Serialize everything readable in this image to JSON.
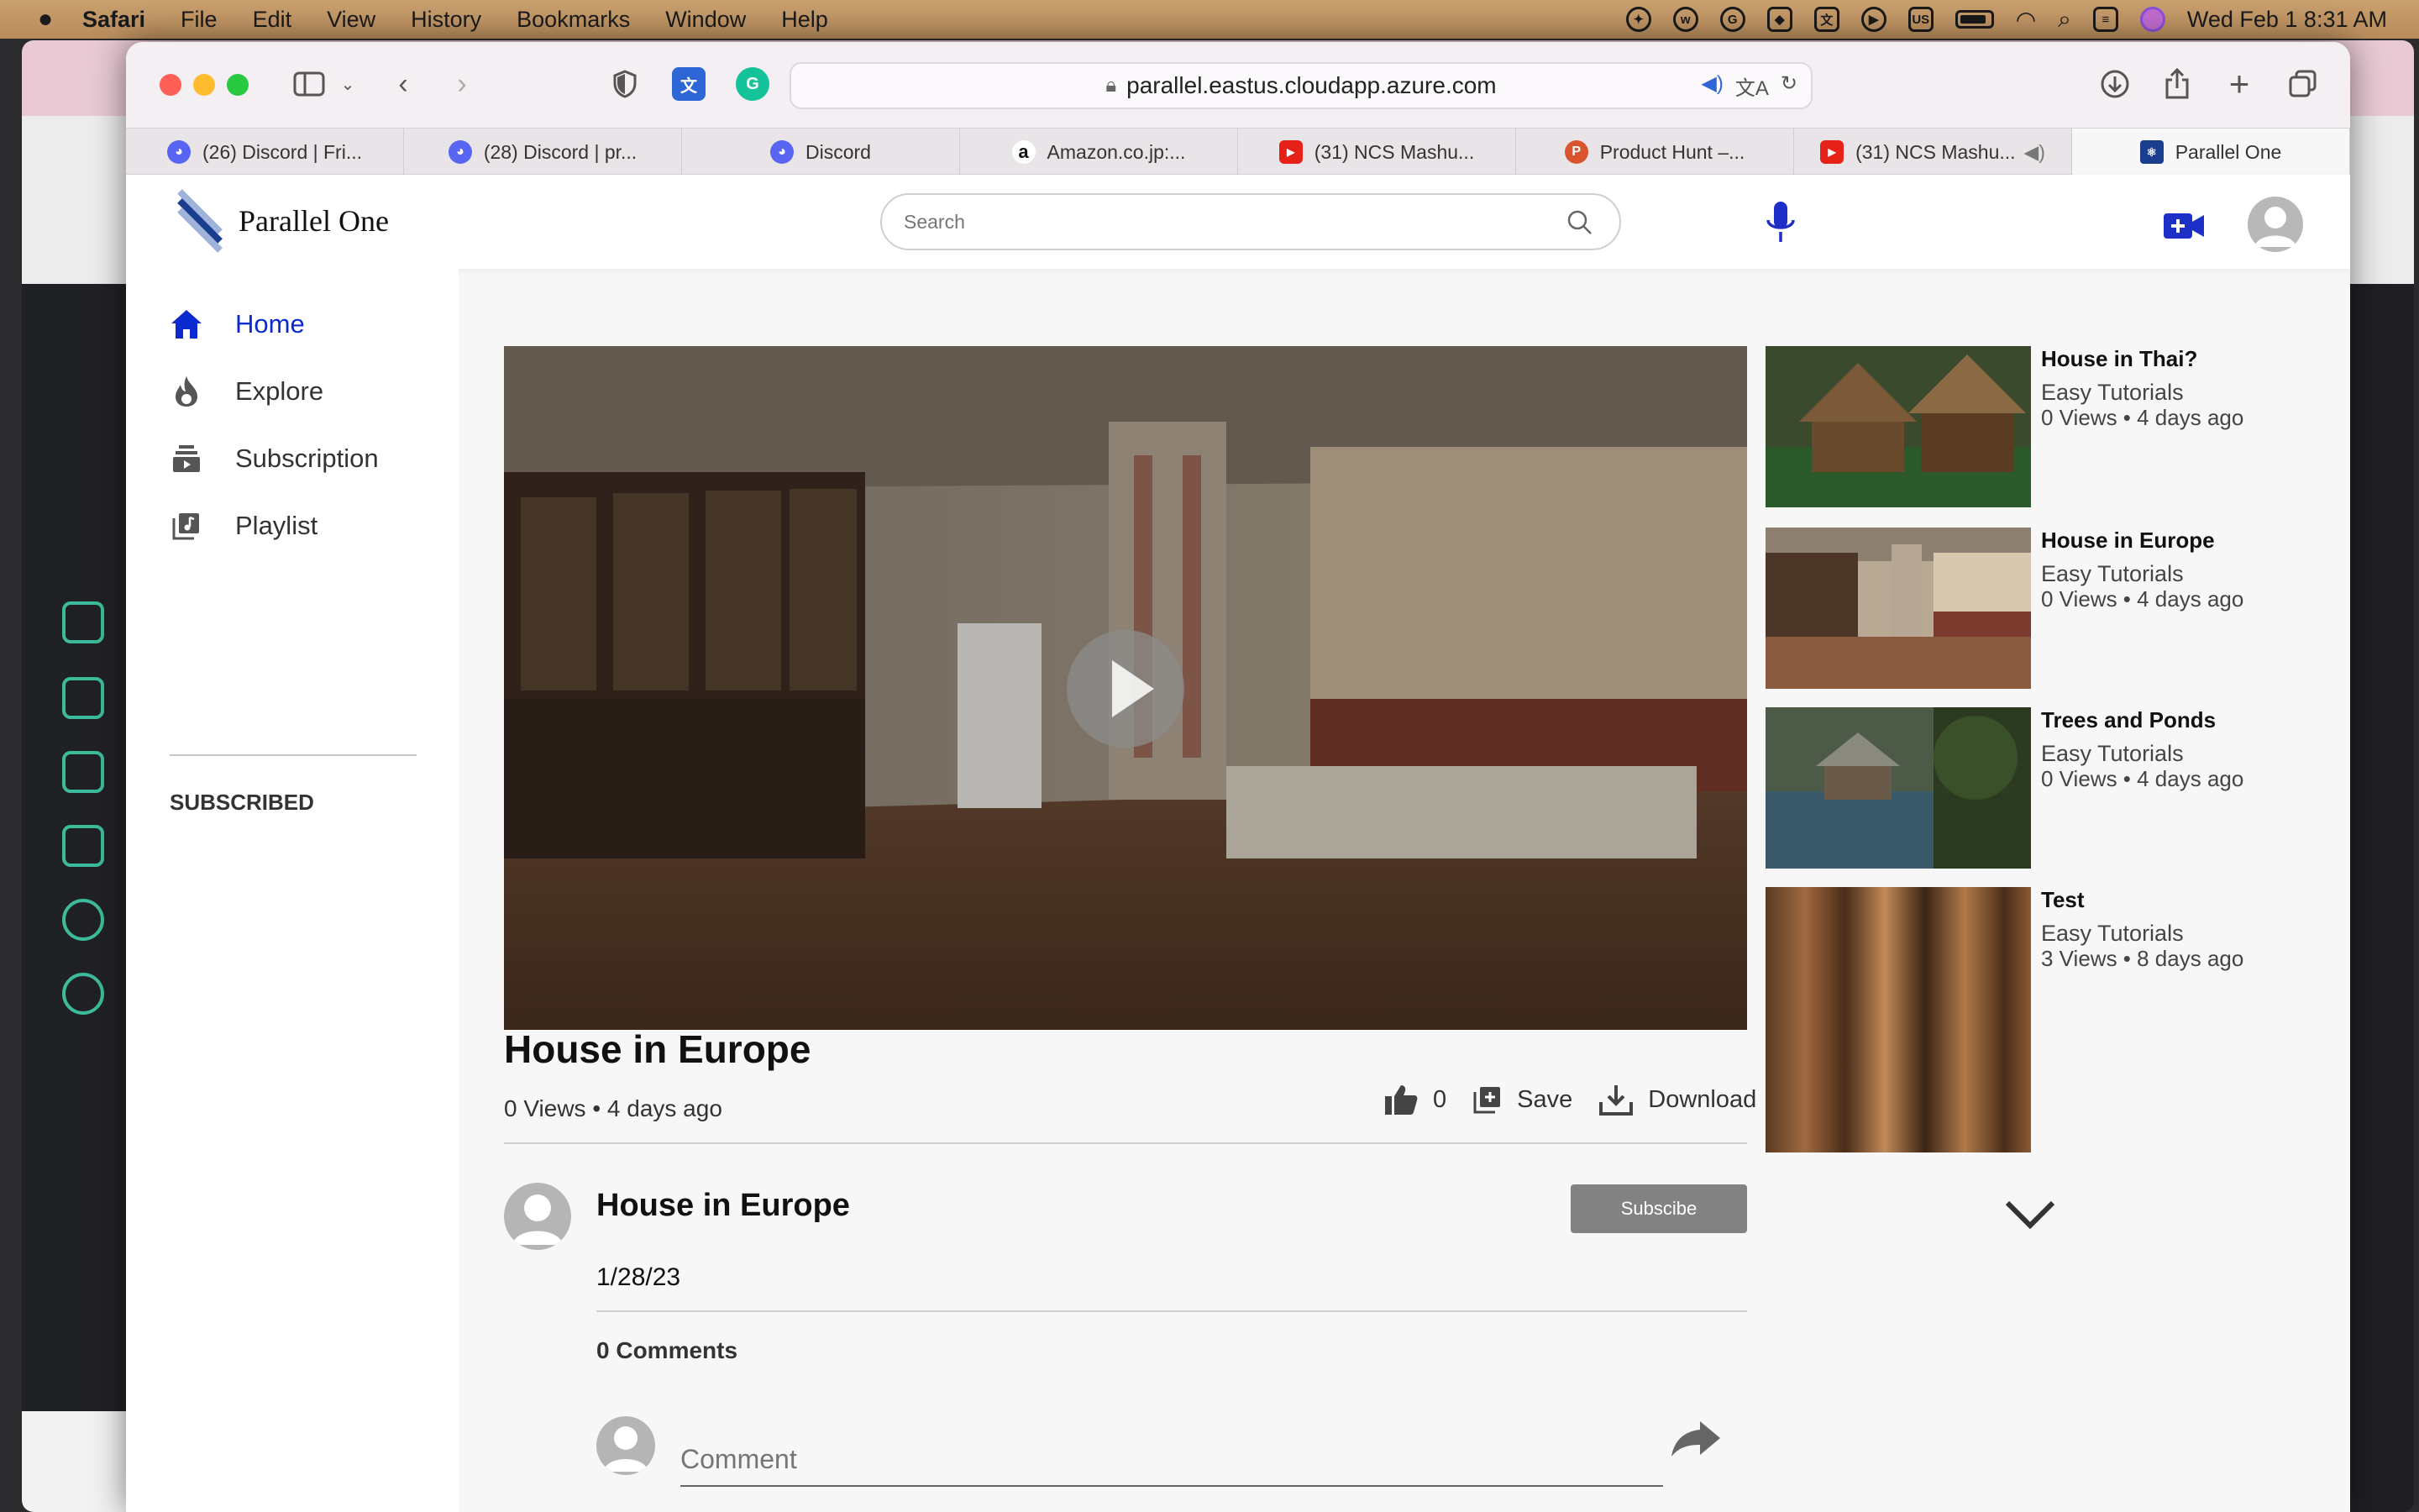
{
  "menubar": {
    "app": "Safari",
    "menus": [
      "File",
      "Edit",
      "View",
      "History",
      "Bookmarks",
      "Window",
      "Help"
    ],
    "input_source": "US",
    "datetime": "Wed Feb 1  8:31 AM"
  },
  "browser": {
    "url": "parallel.eastus.cloudapp.azure.com",
    "tabs": [
      {
        "label": "(26) Discord | Fri...",
        "icon": "discord-icon",
        "color": "#5865f2"
      },
      {
        "label": "(28) Discord | pr...",
        "icon": "discord-icon",
        "color": "#5865f2"
      },
      {
        "label": "Discord",
        "icon": "discord-icon",
        "color": "#5865f2"
      },
      {
        "label": "Amazon.co.jp:...",
        "icon": "amazon-icon",
        "color": "#111111"
      },
      {
        "label": "(31) NCS Mashu...",
        "icon": "youtube-icon",
        "color": "#e62117"
      },
      {
        "label": "Product Hunt –...",
        "icon": "producthunt-icon",
        "color": "#da552f"
      },
      {
        "label": "(31) NCS Mashu...",
        "icon": "youtube-icon",
        "color": "#e62117"
      },
      {
        "label": "Parallel One",
        "icon": "react-icon",
        "color": "#1b3d8f"
      }
    ]
  },
  "site": {
    "name": "Parallel One",
    "search_placeholder": "Search",
    "accent": "#0b2bd0",
    "brand": "#1b3d8f"
  },
  "sidebar": {
    "items": [
      {
        "label": "Home",
        "icon": "home-icon",
        "active": true
      },
      {
        "label": "Explore",
        "icon": "flame-icon",
        "active": false
      },
      {
        "label": "Subscription",
        "icon": "subscription-icon",
        "active": false
      },
      {
        "label": "Playlist",
        "icon": "playlist-icon",
        "active": false
      }
    ],
    "section_title": "SUBSCRIBED"
  },
  "video": {
    "title": "House in Europe",
    "meta": "0 Views • 4 days ago",
    "likes": "0",
    "save_label": "Save",
    "download_label": "Download",
    "channel": "House in Europe",
    "subscribe_label": "Subscibe",
    "date": "1/28/23",
    "comments_count": "0 Comments",
    "comment_placeholder": "Comment"
  },
  "related": [
    {
      "title": "House in Thai?",
      "channel": "Easy Tutorials",
      "meta": "0 Views • 4 days ago"
    },
    {
      "title": "House in Europe",
      "channel": "Easy Tutorials",
      "meta": "0 Views • 4 days ago"
    },
    {
      "title": "Trees and Ponds",
      "channel": "Easy Tutorials",
      "meta": "0 Views • 4 days ago"
    },
    {
      "title": "Test",
      "channel": "Easy Tutorials",
      "meta": "3 Views • 8 days ago"
    }
  ]
}
